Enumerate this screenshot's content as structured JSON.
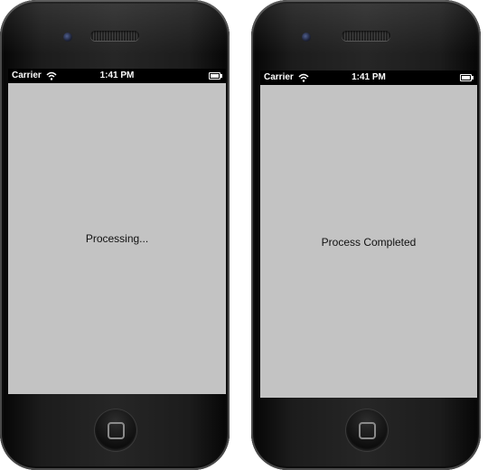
{
  "screens": [
    {
      "status_bar": {
        "carrier": "Carrier",
        "time": "1:41 PM"
      },
      "message": "Processing..."
    },
    {
      "status_bar": {
        "carrier": "Carrier",
        "time": "1:41 PM"
      },
      "message": "Process Completed"
    }
  ],
  "icons": {
    "wifi": "wifi-icon",
    "battery": "battery-icon",
    "home": "home-button-icon",
    "camera": "camera-icon",
    "speaker": "speaker-grille"
  },
  "colors": {
    "screen_background": "#c3c3c3",
    "status_bar": "#000000",
    "phone_body": "#1c1c1c"
  }
}
